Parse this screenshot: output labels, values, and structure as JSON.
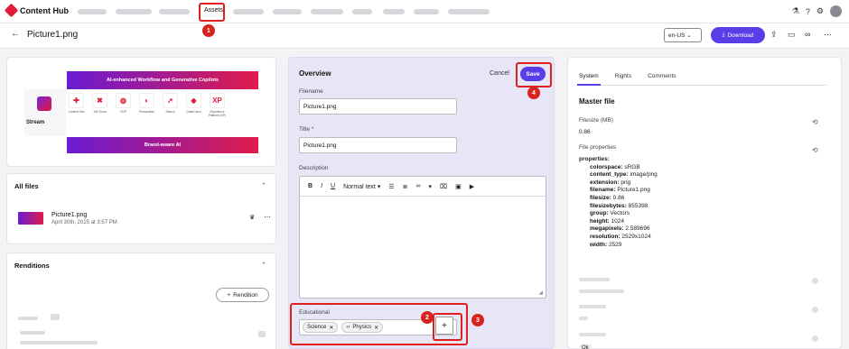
{
  "app": {
    "name": "Content Hub"
  },
  "nav": {
    "active_item": "Assets"
  },
  "header": {
    "title": "Picture1.png",
    "locale": "en-US",
    "download_label": "Download"
  },
  "preview": {
    "banner_top": "AI-enhanced Workflow and Generative Copilots",
    "banner_bottom": "Brand-aware AI",
    "brand": "Stream",
    "tiles": [
      {
        "label": "Content Hub",
        "glyph": "✚"
      },
      {
        "label": "XM Cloud",
        "glyph": "✖"
      },
      {
        "label": "CDP",
        "glyph": "◍"
      },
      {
        "label": "Personalize",
        "glyph": "◐"
      },
      {
        "label": "Search",
        "glyph": "➚"
      },
      {
        "label": "OrderCloud",
        "glyph": "◆"
      },
      {
        "label": "Experience Platform (XP)",
        "glyph": "XP"
      }
    ]
  },
  "all_files": {
    "title": "All files",
    "file_name": "Picture1.png",
    "file_date": "April 30th, 2025 at 3:57 PM"
  },
  "renditions": {
    "title": "Renditions",
    "add_label": "Rendition"
  },
  "overview": {
    "title": "Overview",
    "cancel_label": "Cancel",
    "save_label": "Save",
    "filename_label": "Filename",
    "filename_value": "Picture1.png",
    "title_label": "Title *",
    "title_value": "Picture1.png",
    "description_label": "Description",
    "text_style": "Normal text",
    "educational_label": "Educational",
    "tags": [
      "Science",
      "Physics"
    ]
  },
  "callouts": [
    "1",
    "2",
    "3",
    "4"
  ],
  "details": {
    "tabs": [
      "System",
      "Rights",
      "Comments"
    ],
    "master_title": "Master file",
    "filesize_label": "Filesize (MB)",
    "filesize_value": "0.86",
    "file_properties_label": "File properties",
    "properties_head": "properties:",
    "properties": [
      {
        "key": "colorspace:",
        "value": "sRGB"
      },
      {
        "key": "content_type:",
        "value": "image/png"
      },
      {
        "key": "extension:",
        "value": "png"
      },
      {
        "key": "filename:",
        "value": "Picture1.png"
      },
      {
        "key": "filesize:",
        "value": "0.86"
      },
      {
        "key": "filesizebytes:",
        "value": "855398"
      },
      {
        "key": "group:",
        "value": "Vectors"
      },
      {
        "key": "height:",
        "value": "1024"
      },
      {
        "key": "megapixels:",
        "value": "2.589696"
      },
      {
        "key": "resolution:",
        "value": "2529x1024"
      },
      {
        "key": "width:",
        "value": "2529"
      }
    ],
    "footer_value": "Ok"
  },
  "colors": {
    "accent": "#5b3de8",
    "brand_red": "#e21b3c",
    "callout": "#d9231f"
  }
}
